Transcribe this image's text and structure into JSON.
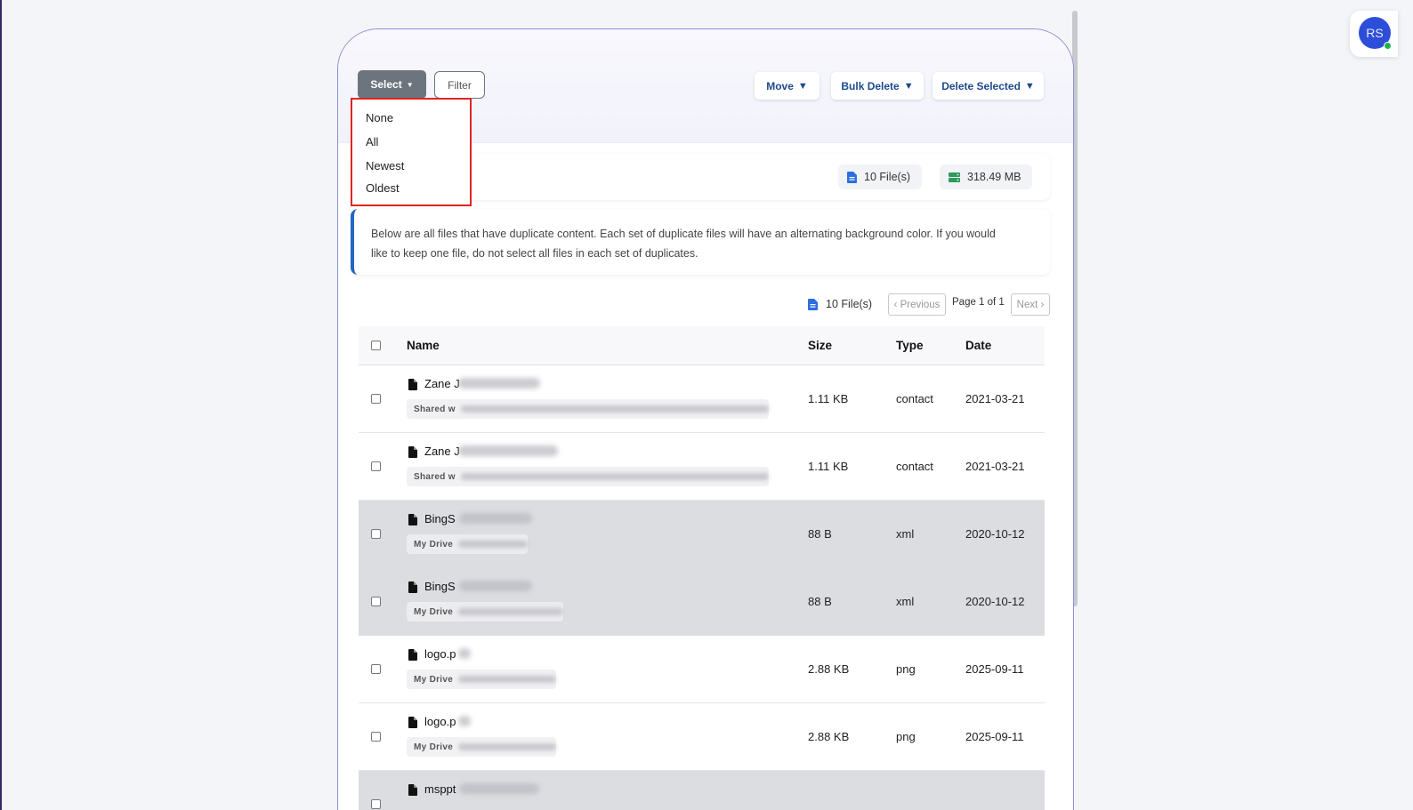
{
  "header": {
    "select_label": "Select",
    "filter_label": "Filter",
    "move_label": "Move",
    "bulk_delete_label": "Bulk Delete",
    "delete_selected_label": "Delete Selected"
  },
  "select_menu": {
    "items": [
      "None",
      "All",
      "Newest",
      "Oldest"
    ]
  },
  "stats": {
    "files": "10 File(s)",
    "total_size": "318.49 MB"
  },
  "info_text_line1": "Below are all files that have duplicate content. Each set of duplicate files will have an alternating background color. If you would",
  "info_text_line2": "like to keep one file, do not select all files in each set of duplicates.",
  "pagination": {
    "files": "10 File(s)",
    "previous": "‹ Previous",
    "page_label": "Page 1 of 1",
    "next": "Next ›"
  },
  "table": {
    "columns": [
      "Name",
      "Size",
      "Type",
      "Date"
    ],
    "rows": [
      {
        "name": "Zane J",
        "location": "Shared w",
        "size": "1.11 KB",
        "type": "contact",
        "date": "2021-03-21"
      },
      {
        "name": "Zane J",
        "location": "Shared w",
        "size": "1.11 KB",
        "type": "contact",
        "date": "2021-03-21"
      },
      {
        "name": "BingS",
        "location": "My Drive",
        "size": "88 B",
        "type": "xml",
        "date": "2020-10-12"
      },
      {
        "name": "BingS",
        "location": "My Drive",
        "size": "88 B",
        "type": "xml",
        "date": "2020-10-12"
      },
      {
        "name": "logo.p",
        "location": "My Drive",
        "size": "2.88 KB",
        "type": "png",
        "date": "2025-09-11"
      },
      {
        "name": "logo.p",
        "location": "My Drive",
        "size": "2.88 KB",
        "type": "png",
        "date": "2025-09-11"
      },
      {
        "name": "msppt",
        "location": "",
        "size": "",
        "type": "",
        "date": ""
      }
    ]
  },
  "user": {
    "initials": "RS",
    "status": "online"
  },
  "colors": {
    "accent": "#1d4a8c",
    "select_button": "#6c757d",
    "highlight_border": "#e02424",
    "avatar": "#2d4ed8",
    "online": "#22b24c",
    "alt_row": "#dcdde1"
  },
  "icons": {
    "file": "file-icon",
    "document": "document-icon",
    "storage": "storage-icon",
    "caret": "caret-down-icon"
  }
}
